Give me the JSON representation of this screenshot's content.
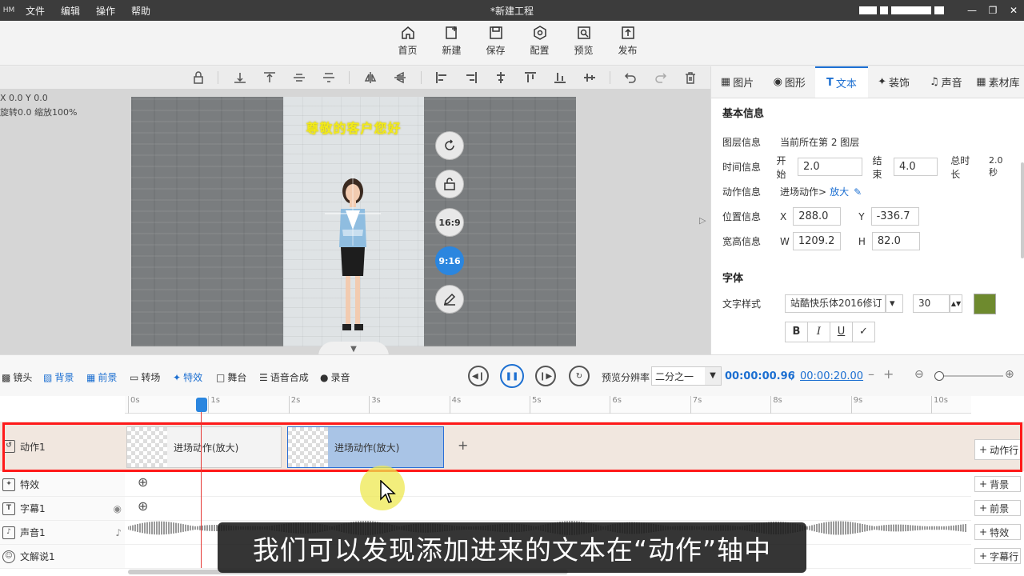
{
  "titlebar": {
    "logo": "HM",
    "menu": [
      "文件",
      "编辑",
      "操作",
      "帮助"
    ],
    "title": "*新建工程"
  },
  "main_toolbar": [
    {
      "label": "首页",
      "icon": "home-icon"
    },
    {
      "label": "新建",
      "icon": "new-icon"
    },
    {
      "label": "保存",
      "icon": "save-icon"
    },
    {
      "label": "配置",
      "icon": "settings-icon"
    },
    {
      "label": "预览",
      "icon": "preview-icon"
    },
    {
      "label": "发布",
      "icon": "publish-icon"
    }
  ],
  "canvas": {
    "coord_line1": "X 0.0 Y 0.0",
    "coord_line2": "旋转0.0 缩放100%",
    "frame_text": "尊敬的客户您好",
    "side_buttons": {
      "ratio_169": "16:9",
      "ratio_916": "9:16"
    }
  },
  "right_panel": {
    "tabs": [
      {
        "label": "图片",
        "icon": "image-icon"
      },
      {
        "label": "图形",
        "icon": "shape-icon"
      },
      {
        "label": "文本",
        "icon": "text-icon"
      },
      {
        "label": "装饰",
        "icon": "decoration-icon"
      },
      {
        "label": "声音",
        "icon": "sound-icon"
      },
      {
        "label": "素材库",
        "icon": "library-icon"
      }
    ],
    "basic_info_title": "基本信息",
    "layer_label": "图层信息",
    "layer_value": "当前所在第 2 图层",
    "time_label": "时间信息",
    "start_label": "开始",
    "start_value": "2.0",
    "end_label": "结束",
    "end_value": "4.0",
    "duration_label": "总时长",
    "duration_value": "2.0 秒",
    "action_label": "动作信息",
    "action_entry": "进场动作>",
    "action_effect": "放大",
    "position_label": "位置信息",
    "x_label": "X",
    "x_value": "288.0",
    "y_label": "Y",
    "y_value": "-336.7",
    "size_label": "宽高信息",
    "w_label": "W",
    "w_value": "1209.2",
    "h_label": "H",
    "h_value": "82.0",
    "font_title": "字体",
    "font_style_label": "文字样式",
    "font_name": "站酷快乐体2016修订",
    "font_size": "30",
    "font_color": "#6e8a2e",
    "format_buttons": [
      "B",
      "I",
      "U"
    ]
  },
  "timeline_toolbar": {
    "left_items": [
      {
        "label": "镜头",
        "icon": "camera-icon"
      },
      {
        "label": "背景",
        "icon": "background-icon"
      },
      {
        "label": "前景",
        "icon": "foreground-icon"
      },
      {
        "label": "转场",
        "icon": "transition-icon"
      },
      {
        "label": "特效",
        "icon": "effect-icon"
      },
      {
        "label": "舞台",
        "icon": "stage-icon"
      },
      {
        "label": "语音合成",
        "icon": "tts-icon"
      },
      {
        "label": "录音",
        "icon": "mic-icon"
      }
    ],
    "resolution_label": "预览分辨率",
    "resolution_value": "二分之一",
    "current_time": "00:00:00.96",
    "separator": "/",
    "total_time": "00:00:20.00"
  },
  "ruler_ticks": [
    "0s",
    "1s",
    "2s",
    "3s",
    "4s",
    "5s",
    "6s",
    "7s",
    "8s",
    "9s",
    "10s"
  ],
  "tracks": {
    "action": {
      "name": "动作1",
      "clips": [
        "进场动作(放大)",
        "进场动作(放大)"
      ],
      "right_button": "动作行"
    },
    "effect": {
      "name": "特效",
      "right_button": "背景"
    },
    "subtitle": {
      "name": "字幕1",
      "right_button": "前景"
    },
    "audio": {
      "name": "声音1",
      "right_button": "特效"
    },
    "narration": {
      "name": "文解说1",
      "right_button": "字幕行"
    }
  },
  "overlay_subtitle": "我们可以发现添加进来的文本在“动作”轴中",
  "colors": {
    "accent": "#1c6fd1",
    "highlight": "#ff1a1a"
  }
}
